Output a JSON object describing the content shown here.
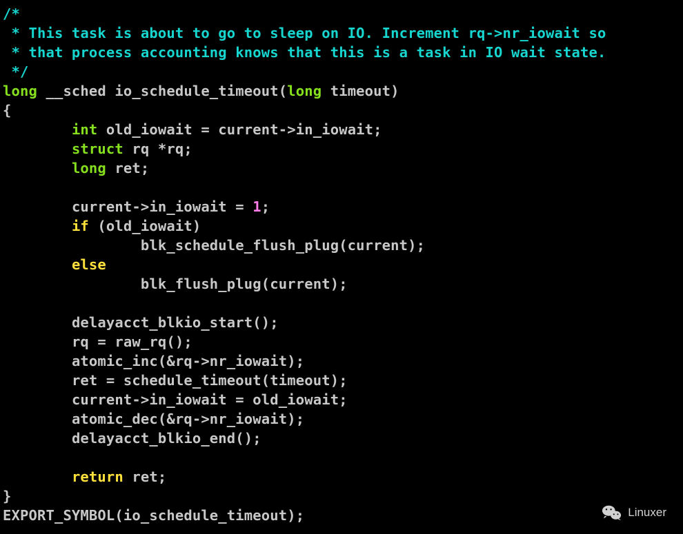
{
  "comment": {
    "l1": "/*",
    "l2": " * This task is about to go to sleep on IO. Increment rq->nr_iowait so",
    "l3": " * that process accounting knows that this is a task in IO wait state.",
    "l4": " */"
  },
  "kw": {
    "long": "long",
    "int": "int",
    "struct": "struct",
    "if": "if",
    "else": "else",
    "return": "return"
  },
  "code": {
    "sig_pre": " __sched io_schedule_timeout(",
    "sig_post": " timeout)",
    "open_brace": "{",
    "close_brace": "}",
    "decl_old_iowait": " old_iowait = current->in_iowait;",
    "decl_rq": " rq *rq;",
    "decl_ret": " ret;",
    "set_in_iowait_pre": "current->in_iowait = ",
    "one": "1",
    "semicolon": ";",
    "if_cond": " (old_iowait)",
    "blk_sched_flush": "blk_schedule_flush_plug(current);",
    "blk_flush": "blk_flush_plug(current);",
    "delay_start": "delayacct_blkio_start();",
    "rq_raw": "rq = raw_rq();",
    "atomic_inc": "atomic_inc(&rq->nr_iowait);",
    "sched_timeout": "ret = schedule_timeout(timeout);",
    "restore_iowait": "current->in_iowait = old_iowait;",
    "atomic_dec": "atomic_dec(&rq->nr_iowait);",
    "delay_end": "delayacct_blkio_end();",
    "return_ret": " ret;",
    "export_symbol": "EXPORT_SYMBOL(io_schedule_timeout);"
  },
  "indent": {
    "i1": "        ",
    "i2": "                "
  },
  "watermark": {
    "text": "Linuxer"
  }
}
